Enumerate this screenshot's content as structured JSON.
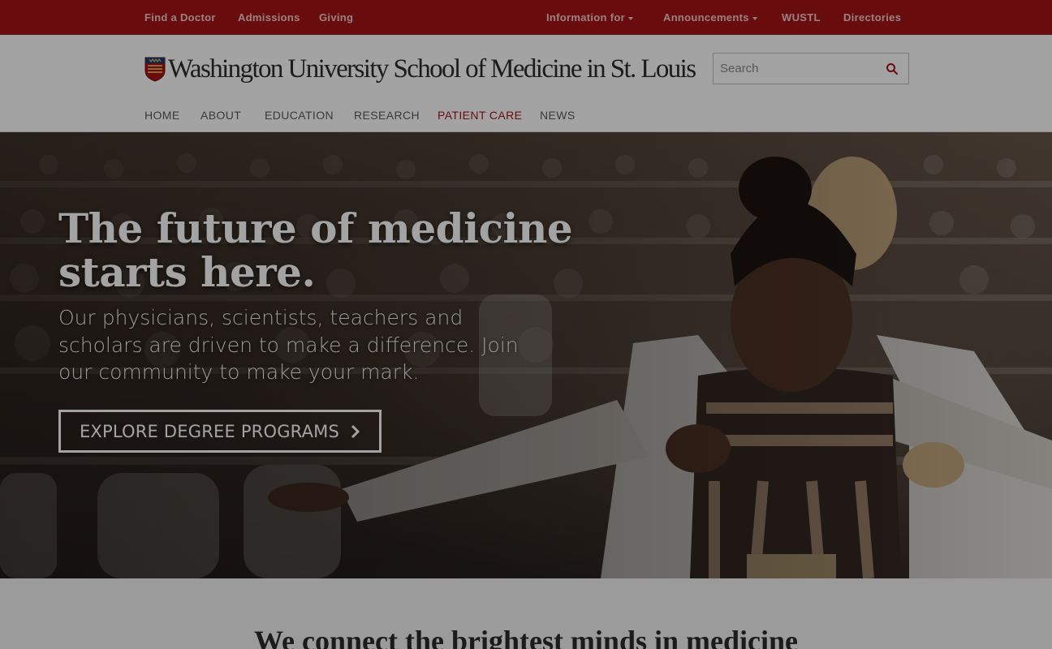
{
  "utility_nav": {
    "items": [
      {
        "label": "Find a Doctor"
      },
      {
        "label": "Admissions"
      },
      {
        "label": "Giving"
      },
      {
        "label": "Information for"
      },
      {
        "label": "Announcements"
      },
      {
        "label": "WUSTL"
      },
      {
        "label": "Directories"
      }
    ]
  },
  "header": {
    "logo_text": "Washington University School of Medicine in St. Louis",
    "search": {
      "placeholder": "Search"
    }
  },
  "main_nav": {
    "items": [
      {
        "label": "HOME"
      },
      {
        "label": "ABOUT"
      },
      {
        "label": "EDUCATION"
      },
      {
        "label": "RESEARCH"
      },
      {
        "label": "PATIENT CARE"
      },
      {
        "label": "NEWS"
      }
    ]
  },
  "hero": {
    "title_line1": "The future of medicine",
    "title_line2": "starts here.",
    "subtitle": "Our physicians, scientists, teachers and scholars are driven to make a difference. Join our community to make your mark.",
    "cta_label": "EXPLORE DEGREE PROGRAMS"
  },
  "intro": {
    "heading": "We connect the brightest minds in medicine"
  },
  "colors": {
    "brand_red": "#a51417",
    "nav_text": "#5a5a5a",
    "active_nav": "#a51417"
  },
  "icons": {
    "search": "search-icon",
    "cta_chevron": "chevron-right-icon",
    "logo": "university-shield-logo"
  }
}
